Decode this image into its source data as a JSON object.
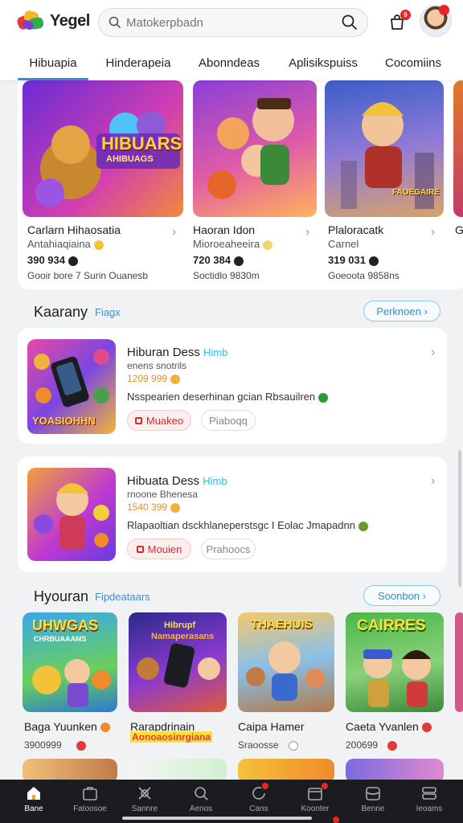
{
  "app": {
    "logo_text": "Yegel"
  },
  "search": {
    "placeholder": "Matokerpbadn"
  },
  "header": {
    "cart_badge": "9"
  },
  "tabs": [
    "Hibuapia",
    "Hinderapeia",
    "Abonndeas",
    "Aplisikspuiss",
    "Cocomiins"
  ],
  "featured": [
    {
      "title": "Carlarn Hihaosatia",
      "subtitle": "Antahiaqiaina",
      "count": "390 934",
      "meta": "Gooir bore 7 Surin Ouanesb",
      "art_text": "HIBUARS",
      "art_sub": "AHIBUAGS"
    },
    {
      "title": "Haoran Idon",
      "subtitle": "Mioroeaheeira",
      "count": "720 384",
      "meta": "Soctidlo 9830m",
      "art_text": "",
      "art_sub": ""
    },
    {
      "title": "Plaloracatk",
      "subtitle": "Carnel",
      "count": "319 031",
      "meta": "Goeoota 9858ns",
      "art_text": "FAOEGAIRE",
      "art_sub": ""
    },
    {
      "title": "G",
      "subtitle": "",
      "count": "",
      "meta": "",
      "art_text": "",
      "art_sub": ""
    }
  ],
  "section1": {
    "title": "Kaarany",
    "tag": "Fiagx",
    "pill": "Perknoen"
  },
  "list_items": [
    {
      "title": "Hiburan Dess",
      "tag": "Himb",
      "subtitle": "enens snotrils",
      "count": "1209 999",
      "desc": "Nsspearien deserhinan gcian Rbsauilren",
      "primary": "Muakeo",
      "secondary": "Piaboqq",
      "art_text": "YOASIOHHN"
    },
    {
      "title": "Hibuata Dess",
      "tag": "Himb",
      "subtitle": "rnoone Bhenesa",
      "count": "1540 399",
      "desc": "Rlapaoltian dsckhlaneperstsgc I Eolac Jmapadnn",
      "primary": "Mouien",
      "secondary": "Prahoocs",
      "art_text": ""
    }
  ],
  "section2": {
    "title": "Hyouran",
    "tag": "Fipdeataars",
    "pill": "Soonbon"
  },
  "grid": [
    {
      "title": "Baga Yuunken",
      "count": "3900999",
      "art_text": "UHWGAS",
      "art_sub": "CHRBUAAAMS"
    },
    {
      "title": "Rarapdrinain",
      "count": "Aonoaosinrgiana",
      "art_text": "Hibrupf",
      "art_sub": "Namaperasans"
    },
    {
      "title": "Caipa Hamer",
      "count": "Sraoosse",
      "art_text": "THAEHUIS",
      "art_sub": ""
    },
    {
      "title": "Caeta Yvanlen",
      "count": "200699",
      "art_text": "CAIRRES",
      "art_sub": ""
    }
  ],
  "nav": [
    "Bane",
    "Fatoosoe",
    "Sannre",
    "Aenos",
    "Cans",
    "Koonter",
    "Benne",
    "Ieoams"
  ],
  "colors": {
    "accent": "#2f8fd8",
    "badge": "#e8242b",
    "nav_bg": "#1b1c20"
  }
}
